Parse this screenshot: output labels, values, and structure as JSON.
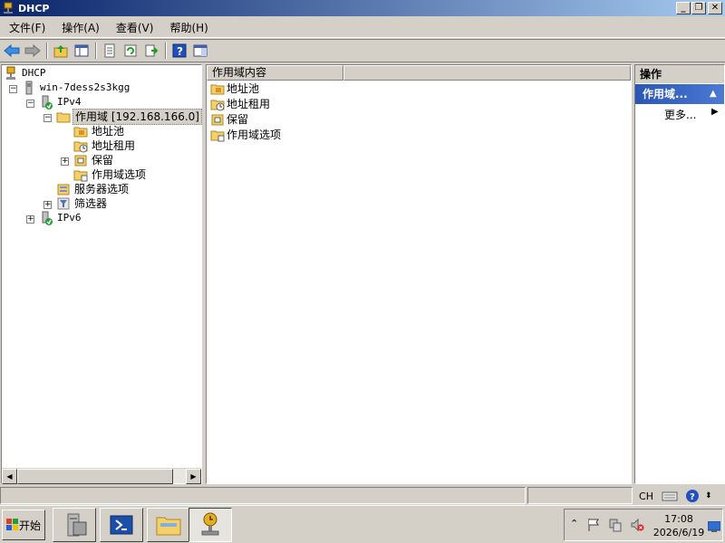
{
  "window": {
    "title": "DHCP"
  },
  "menu": {
    "items": [
      "文件(F)",
      "操作(A)",
      "查看(V)",
      "帮助(H)"
    ]
  },
  "tree": {
    "root": "DHCP",
    "server": "win-7dess2s3kgg",
    "ipv4": "IPv4",
    "scope": "作用域 [192.168.166.0]",
    "address_pool": "地址池",
    "address_leases": "地址租用",
    "reservations": "保留",
    "scope_options": "作用域选项",
    "server_options": "服务器选项",
    "filters": "筛选器",
    "ipv6": "IPv6"
  },
  "content": {
    "column_header": "作用域内容",
    "items": [
      "地址池",
      "地址租用",
      "保留",
      "作用域选项"
    ]
  },
  "actions": {
    "header": "操作",
    "group": "作用域...",
    "more": "更多..."
  },
  "taskbar": {
    "start": "开始",
    "lang": "CH",
    "time": "17:08",
    "date": "2026/6/19"
  }
}
